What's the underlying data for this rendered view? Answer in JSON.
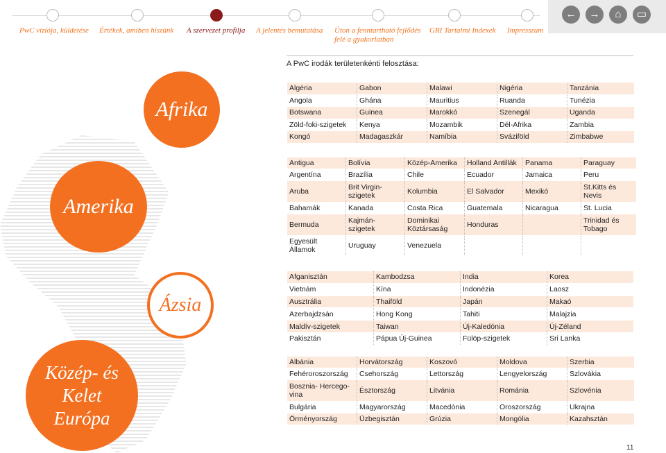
{
  "nav": {
    "items": [
      {
        "label": "PwC víziója, küldetése",
        "active": false
      },
      {
        "label": "Értékek, amiben hiszünk",
        "active": false
      },
      {
        "label": "A szervezet profilja",
        "active": true
      },
      {
        "label": "A jelentés bemutatása",
        "active": false
      },
      {
        "label": "Úton a fenntartható fejlődés felé a gyakorlatban",
        "active": false
      },
      {
        "label": "GRI Tartalmi Indexek",
        "active": false
      },
      {
        "label": "Impresszum",
        "active": false
      }
    ],
    "buttons": [
      {
        "icon": "arrow-left-icon",
        "glyph": "←"
      },
      {
        "icon": "arrow-right-icon",
        "glyph": "→"
      },
      {
        "icon": "home-icon",
        "glyph": "⌂"
      },
      {
        "icon": "window-icon",
        "glyph": "▭"
      }
    ]
  },
  "heading": "A PwC irodák területenkénti felosztása:",
  "regions": [
    {
      "name": "Afrika",
      "rows": [
        [
          "Algéria",
          "Gabon",
          "Malawi",
          "Nigéria",
          "Tanzánia"
        ],
        [
          "Angola",
          "Ghána",
          "Mauritius",
          "Ruanda",
          "Tunézia"
        ],
        [
          "Botswana",
          "Guinea",
          "Marokkó",
          "Szenegál",
          "Uganda"
        ],
        [
          "Zöld-foki-szigetek",
          "Kenya",
          "Mozambik",
          "Dél-Afrika",
          "Zambia"
        ],
        [
          "Kongó",
          "Madagaszkár",
          "Namíbia",
          "Sváziföld",
          "Zimbabwe"
        ]
      ]
    },
    {
      "name": "Amerika",
      "rows": [
        [
          "Antigua",
          "Bolívia",
          "Közép-Amerika",
          "Holland Antillák",
          "Panama",
          "Paraguay"
        ],
        [
          "Argentína",
          "Brazília",
          "Chile",
          "Ecuador",
          "Jamaica",
          "Peru"
        ],
        [
          "Aruba",
          "Brit Virgin- szigetek",
          "Kolumbia",
          "El Salvador",
          "Mexikó",
          "St.Kitts és Nevis"
        ],
        [
          "Bahamák",
          "Kanada",
          "Costa Rica",
          "Guatemala",
          "Nicaragua",
          "St. Lucia"
        ],
        [
          "Bermuda",
          "Kajmán- szigetek",
          "Dominikai Köztársaság",
          "Honduras",
          "",
          "Trinidad és Tobago"
        ],
        [
          "Egyesült Államok",
          "Uruguay",
          "Venezuela",
          "",
          "",
          ""
        ]
      ]
    },
    {
      "name": "Ázsia",
      "rows": [
        [
          "Afganisztán",
          "Kambodzsa",
          "India",
          "Korea"
        ],
        [
          "Vietnám",
          "Kína",
          "Indonézia",
          "Laosz"
        ],
        [
          "Ausztrália",
          "Thaiföld",
          "Japán",
          "Makaó"
        ],
        [
          "Azerbajdzsán",
          "Hong Kong",
          "Tahiti",
          "Malajzia"
        ],
        [
          "Maldív-szigetek",
          "Taiwan",
          "Új-Kaledónia",
          "Új-Zéland"
        ],
        [
          "Pakisztán",
          "Pápua Új-Guinea",
          "Fülöp-szigetek",
          "Sri Lanka"
        ]
      ]
    },
    {
      "name": "Közép- és Kelet Európa",
      "rows": [
        [
          "Albánia",
          "Horvátország",
          "Koszovó",
          "Moldova",
          "Szerbia"
        ],
        [
          "Fehéroroszország",
          "Csehország",
          "Lettország",
          "Lengyelország",
          "Szlovákia"
        ],
        [
          "Bosznia- Hercego- vina",
          "Észtország",
          "Litvánia",
          "Románia",
          "Szlovénia"
        ],
        [
          "Bulgária",
          "Magyarország",
          "Macedónia",
          "Oroszország",
          "Ukrajna"
        ],
        [
          "Örményország",
          "Üzbegisztán",
          "Grúzia",
          "Mongólia",
          "Kazahsztán"
        ]
      ]
    }
  ],
  "page_number": "11",
  "colors": {
    "accent": "#f37021",
    "active_nav": "#8b1a1a",
    "row_shade": "#fde9dc"
  }
}
